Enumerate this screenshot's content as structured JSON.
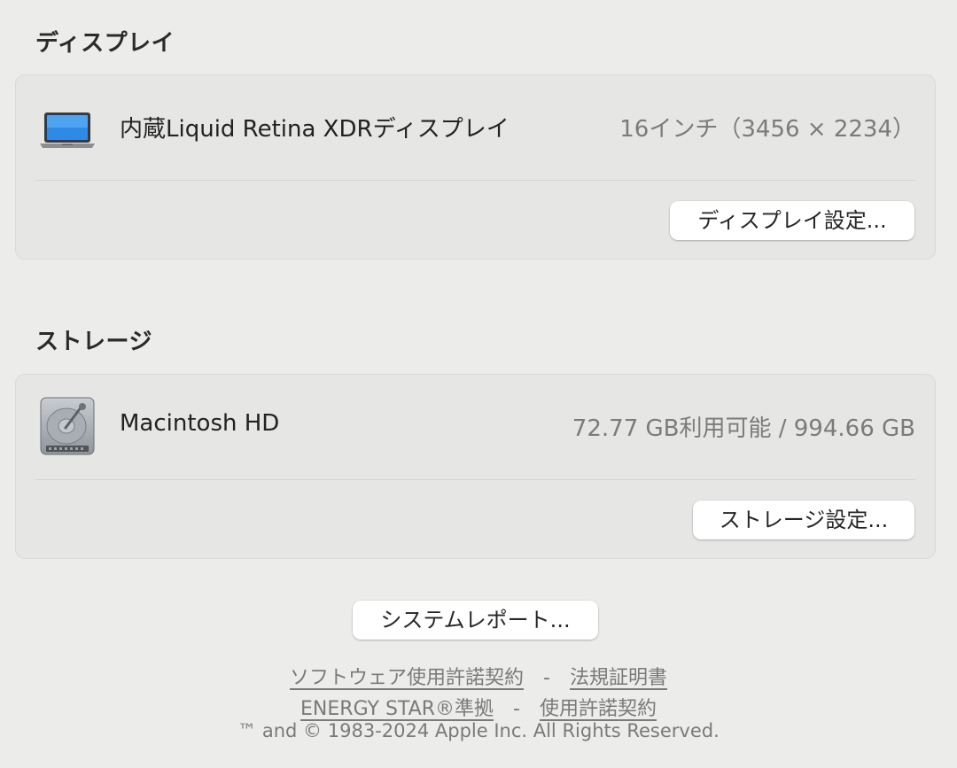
{
  "display_section": {
    "title": "ディスプレイ",
    "icon": "laptop-icon",
    "item_label": "内蔵Liquid Retina XDRディスプレイ",
    "item_value": "16インチ（3456 × 2234）",
    "button_label": "ディスプレイ設定..."
  },
  "storage_section": {
    "title": "ストレージ",
    "icon": "hard-drive-icon",
    "item_label": "Macintosh HD",
    "item_value": "72.77 GB利用可能 / 994.66 GB",
    "button_label": "ストレージ設定..."
  },
  "system_report_button": "システムレポート...",
  "footer": {
    "links_row1": [
      "ソフトウェア使用許諾契約",
      "法規証明書"
    ],
    "links_row2": [
      "ENERGY STAR®準拠",
      "使用許諾契約"
    ],
    "separator": "-",
    "copyright": "™ and © 1983-2024 Apple Inc. All Rights Reserved."
  },
  "colors": {
    "background": "#ececeb",
    "card_background": "#e6e6e5",
    "secondary_text": "#7b7b7b"
  }
}
